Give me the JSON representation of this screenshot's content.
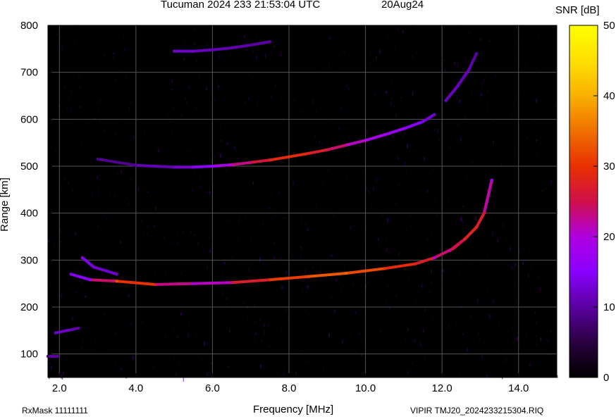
{
  "header": {
    "title": "Tucuman 2024 233 21:53:04 UTC",
    "date": "20Aug24"
  },
  "footer": {
    "left": "RxMask 11111111",
    "right": "VIPIR  TMJ20_2024233215304.RIQ"
  },
  "colors": {
    "plot_background": "#000000",
    "grid": "#555555",
    "colormap": [
      "#000000",
      "#2a0040",
      "#5a00a0",
      "#8a00ff",
      "#b000e0",
      "#d0104a",
      "#e83000",
      "#f07000",
      "#f8b000",
      "#ffe000",
      "#ffff00"
    ]
  },
  "chart_data": {
    "type": "heatmap",
    "xlabel": "Frequency [MHz]",
    "ylabel": "Range [km]",
    "xlim": [
      1.7,
      15.0
    ],
    "ylim": [
      50,
      800
    ],
    "xticks": [
      2.0,
      4.0,
      6.0,
      8.0,
      10.0,
      12.0,
      14.0
    ],
    "xtick_labels": [
      "2.0",
      "4.0",
      "6.0",
      "8.0",
      "10.0",
      "12.0",
      "14.0"
    ],
    "yticks": [
      100,
      200,
      300,
      400,
      500,
      600,
      700,
      800
    ],
    "ytick_labels": [
      "100",
      "200",
      "300",
      "400",
      "500",
      "600",
      "700",
      "800"
    ],
    "colorbar": {
      "label": "SNR [dB]",
      "range": [
        0,
        50
      ],
      "ticks": [
        0,
        10,
        20,
        30,
        40,
        50
      ],
      "tick_labels": [
        "0",
        "10",
        "20",
        "30",
        "40",
        "50"
      ]
    },
    "grid": true,
    "series": [
      {
        "x": [
          2.3,
          2.8,
          3.5,
          4.5,
          5.5,
          6.5,
          7.5,
          8.5,
          9.5,
          10.5,
          11.3,
          11.8
        ],
        "y": [
          270,
          258,
          255,
          248,
          250,
          252,
          258,
          265,
          272,
          282,
          292,
          305
        ],
        "snr": [
          14,
          16,
          32,
          28,
          18,
          24,
          30,
          32,
          34,
          30,
          28,
          26
        ]
      },
      {
        "x": [
          2.6,
          2.9,
          3.5
        ],
        "y": [
          305,
          285,
          270
        ],
        "snr": [
          14,
          13,
          12
        ]
      },
      {
        "x": [
          11.8,
          12.3,
          12.6,
          12.9,
          13.1,
          13.3
        ],
        "y": [
          305,
          325,
          345,
          370,
          400,
          470
        ],
        "snr": [
          20,
          28,
          30,
          28,
          26,
          18
        ]
      },
      {
        "x": [
          12.2,
          12.6,
          12.9,
          13.1,
          13.3
        ],
        "y": [
          320,
          345,
          370,
          400,
          470
        ],
        "snr": [
          22,
          28,
          28,
          26,
          18
        ]
      },
      {
        "x": [
          3.0,
          4.0,
          5.0,
          5.5,
          6.0,
          6.5,
          7.0,
          7.5,
          8.0,
          8.5,
          9.0,
          9.5,
          10.0,
          10.5,
          11.0,
          11.5,
          11.8
        ],
        "y": [
          515,
          502,
          498,
          498,
          500,
          503,
          508,
          513,
          520,
          527,
          535,
          545,
          555,
          567,
          580,
          595,
          610
        ],
        "snr": [
          8,
          10,
          12,
          14,
          16,
          22,
          24,
          28,
          30,
          28,
          26,
          22,
          20,
          18,
          16,
          14,
          12
        ]
      },
      {
        "x": [
          12.1,
          12.4,
          12.7,
          12.9
        ],
        "y": [
          640,
          670,
          705,
          740
        ],
        "snr": [
          12,
          12,
          11,
          10
        ]
      },
      {
        "x": [
          5.0,
          5.5,
          6.0,
          6.5,
          7.0,
          7.5
        ],
        "y": [
          745,
          745,
          748,
          752,
          758,
          765
        ],
        "snr": [
          12,
          12,
          11,
          11,
          10,
          10
        ]
      },
      {
        "x": [
          1.9,
          2.2,
          2.5
        ],
        "y": [
          145,
          150,
          155
        ],
        "snr": [
          12,
          12,
          10
        ]
      },
      {
        "x": [
          1.7,
          1.95
        ],
        "y": [
          95,
          95
        ],
        "snr": [
          10,
          10
        ]
      }
    ]
  }
}
